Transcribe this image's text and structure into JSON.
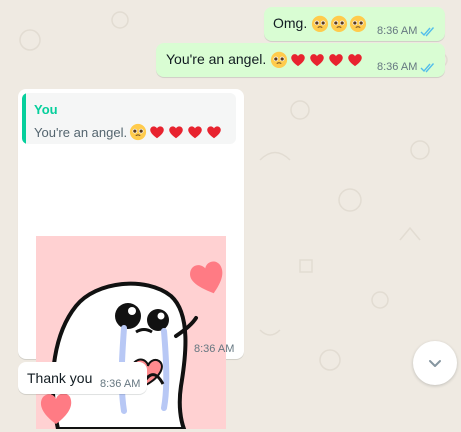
{
  "messages": [
    {
      "text": "Omg.",
      "time": "8:36 AM",
      "emoji_count": 3,
      "emoji_type": "pleading-face",
      "status": "read"
    },
    {
      "text": "You're an angel.",
      "time": "8:36 AM",
      "status": "read"
    }
  ],
  "reply": {
    "quote_author": "You",
    "quote_text": "You're an angel.",
    "time": "8:36 AM",
    "sticker": "crying-blob-with-hearts-sticker"
  },
  "last_message": {
    "text": "Thank you",
    "time": "8:36 AM"
  },
  "colors": {
    "outgoing_bubble": "#d9fdd3",
    "incoming_bubble": "#ffffff",
    "read_ticks": "#53bdeb",
    "quote_accent": "#06cf9c",
    "background": "#efeae2"
  }
}
